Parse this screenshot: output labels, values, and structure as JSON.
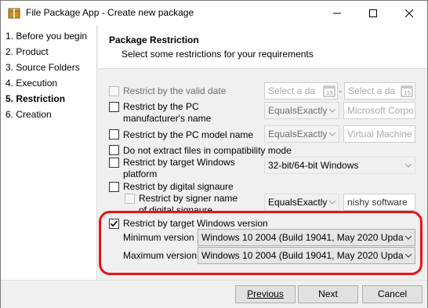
{
  "window": {
    "title": "File Package App - Create new package"
  },
  "steps": [
    {
      "label": "1. Before you begin",
      "active": false
    },
    {
      "label": "2. Product",
      "active": false
    },
    {
      "label": "3. Source Folders",
      "active": false
    },
    {
      "label": "4. Execution",
      "active": false
    },
    {
      "label": "5. Restriction",
      "active": true
    },
    {
      "label": "6. Creation",
      "active": false
    }
  ],
  "header": {
    "title": "Package Restriction",
    "subtitle": "Select some restrictions for your requirements"
  },
  "restrictions": {
    "valid_date": {
      "label": "Restrict by the valid date",
      "checked": false,
      "enabled": false,
      "from_placeholder": "Select a da",
      "to_placeholder": "Select a da",
      "separator": "-"
    },
    "manufacturer": {
      "label_line1": "Restrict by the PC",
      "label_line2": "manufacturer's name",
      "checked": false,
      "operator": "EqualsExactly",
      "value_placeholder": "Microsoft Corpo"
    },
    "model": {
      "label": "Restrict by the PC model name",
      "checked": false,
      "operator": "EqualsExactly",
      "value_placeholder": "Virtual Machine"
    },
    "compat": {
      "label": "Do not extract files in compatibility mode",
      "checked": false
    },
    "platform": {
      "label_line1": "Restrict by target Windows",
      "label_line2": "platform",
      "checked": false,
      "value": "32-bit/64-bit Windows"
    },
    "signature": {
      "label": "Restrict by digital signaure",
      "checked": false
    },
    "signer": {
      "label_line1": "Restrict by signer name",
      "label_line2": "of digital signaure",
      "checked": false,
      "operator": "EqualsExactly",
      "value": "nishy software"
    },
    "win_version": {
      "label": "Restrict by target Windows version",
      "checked": true,
      "min_label": "Minimum version",
      "min_value": "Windows 10 2004 (Build 19041, May 2020 Upda",
      "max_label": "Maximum version",
      "max_value": "Windows 10 2004 (Build 19041, May 2020 Upda"
    }
  },
  "buttons": {
    "previous": "Previous",
    "next": "Next",
    "cancel": "Cancel"
  },
  "colors": {
    "highlight": "#e8131c",
    "titlebar": "#ffffff",
    "dialog": "#f0f0f0"
  },
  "icons": {
    "app": "package-icon",
    "calendar": "calendar-icon"
  }
}
